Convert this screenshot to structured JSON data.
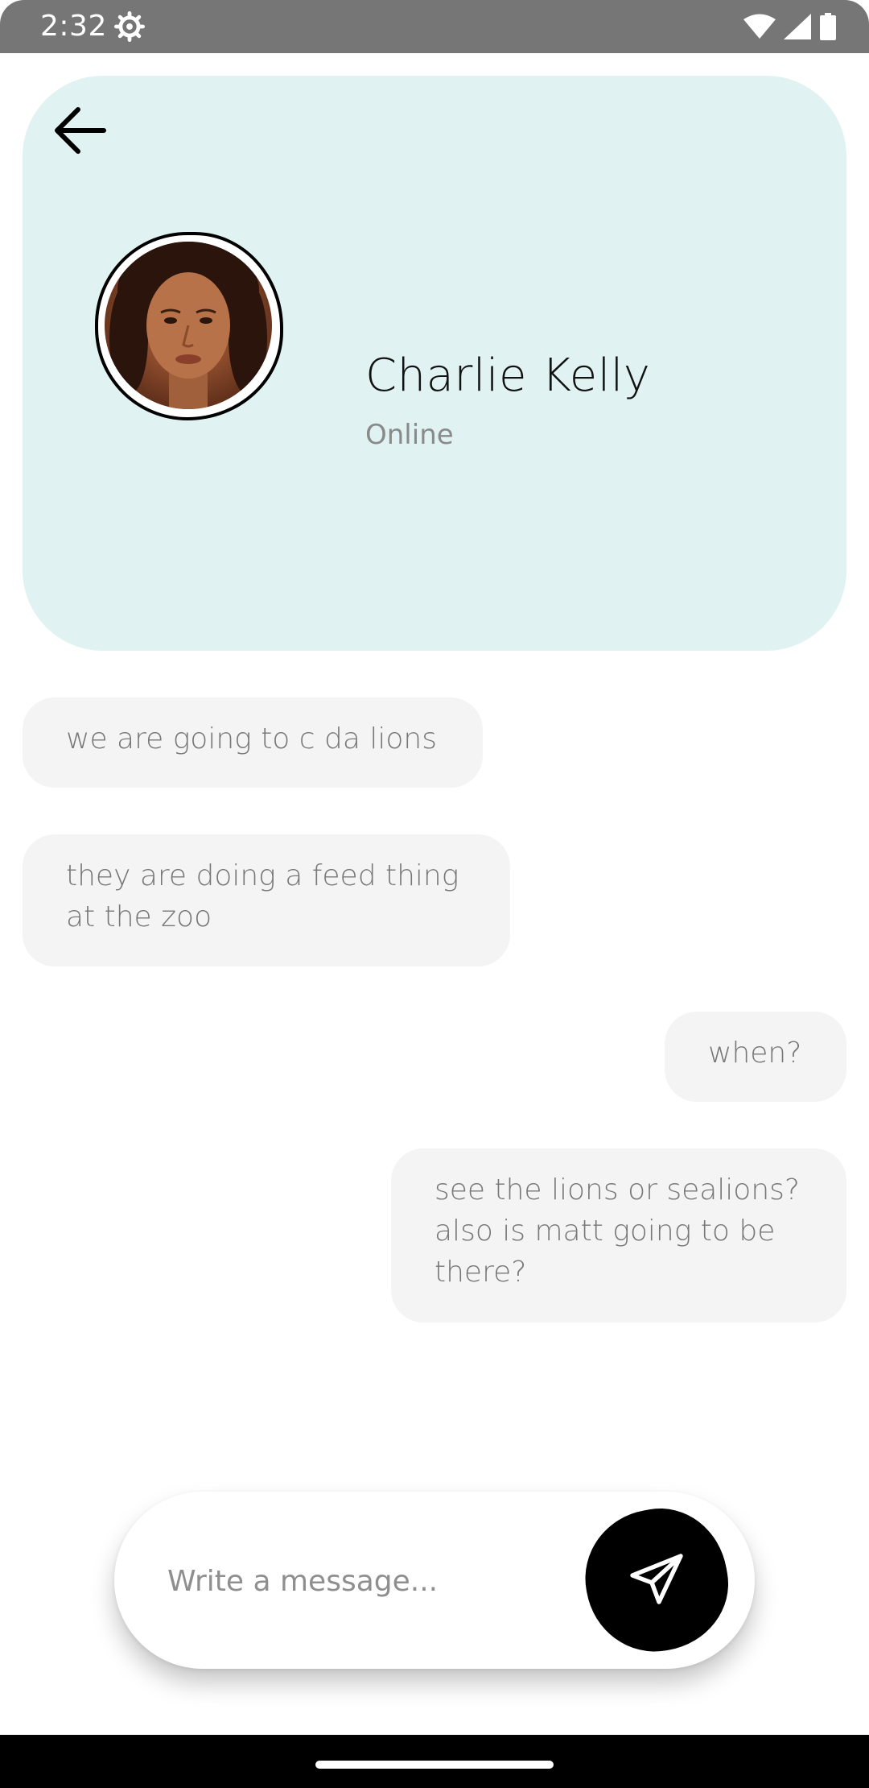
{
  "status_bar": {
    "time": "2:32",
    "icons": [
      "settings-gear-icon",
      "wifi-icon",
      "signal-icon",
      "battery-icon"
    ]
  },
  "header": {
    "back_icon": "arrow-left-icon",
    "contact_name": "Charlie Kelly",
    "contact_status": "Online",
    "background_color": "#e0f3f2"
  },
  "messages": [
    {
      "side": "incoming",
      "text": "we are going to c da lions"
    },
    {
      "side": "incoming",
      "text": "they are doing a feed thing at the zoo"
    },
    {
      "side": "outgoing",
      "text": "when?"
    },
    {
      "side": "outgoing",
      "text": "see the lions or sealions? also is matt going to be there?"
    }
  ],
  "composer": {
    "placeholder": "Write a message...",
    "send_icon": "send-paper-plane-icon"
  }
}
